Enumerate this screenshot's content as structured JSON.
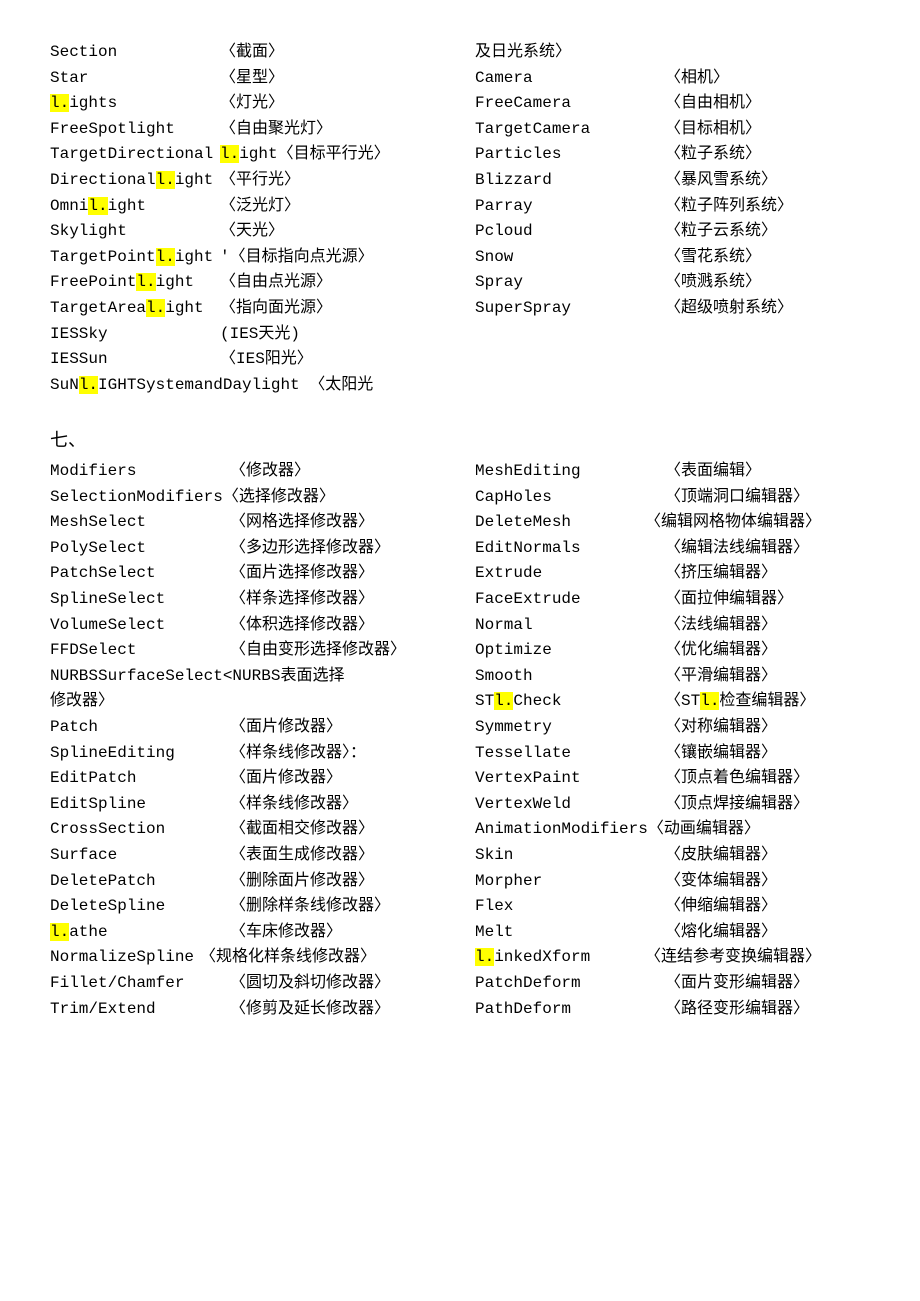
{
  "section1": {
    "left": [
      {
        "term": "Section",
        "def": "〈截面〉"
      },
      {
        "term": "Star",
        "def": "〈星型〉"
      },
      {
        "term_parts": [
          {
            "t": "l.",
            "hl": true
          },
          {
            "t": "ights"
          }
        ],
        "def": "〈灯光〉"
      },
      {
        "term": "FreeSpotlight",
        "def": "〈自由聚光灯〉"
      },
      {
        "term": "TargetDirectional",
        "def_parts": [
          {
            "t": "l.",
            "hl": true
          },
          {
            "t": "ight〈目标平行光〉"
          }
        ]
      },
      {
        "term_parts": [
          {
            "t": "Directional"
          },
          {
            "t": "l.",
            "hl": true
          },
          {
            "t": "ight"
          }
        ],
        "def": "〈平行光〉"
      },
      {
        "term_parts": [
          {
            "t": "Omni"
          },
          {
            "t": "l.",
            "hl": true
          },
          {
            "t": "ight"
          }
        ],
        "def": "〈泛光灯〉"
      },
      {
        "term": "Skylight",
        "def": "〈天光〉"
      },
      {
        "term_parts": [
          {
            "t": "TargetPoint"
          },
          {
            "t": "l.",
            "hl": true
          },
          {
            "t": "ight"
          }
        ],
        "def": "'〈目标指向点光源〉"
      },
      {
        "term_parts": [
          {
            "t": "FreePoint"
          },
          {
            "t": "l.",
            "hl": true
          },
          {
            "t": "ight"
          }
        ],
        "def": "〈自由点光源〉"
      },
      {
        "term_parts": [
          {
            "t": "TargetArea"
          },
          {
            "t": "l.",
            "hl": true
          },
          {
            "t": "ight"
          }
        ],
        "def": "〈指向面光源〉"
      },
      {
        "term": "IESSky",
        "def": "(IES天光)"
      },
      {
        "term": "IESSun",
        "def": "〈IES阳光〉"
      },
      {
        "full_parts": [
          {
            "t": "SuN"
          },
          {
            "t": "l.",
            "hl": true
          },
          {
            "t": "IGHTSystemandDaylight 〈太阳光"
          }
        ]
      }
    ],
    "right": [
      {
        "term": "及日光系统〉",
        "def": ""
      },
      {
        "term": "Camera",
        "def": "〈相机〉"
      },
      {
        "term": "FreeCamera",
        "def": "〈自由相机〉"
      },
      {
        "term": "TargetCamera",
        "def": "〈目标相机〉"
      },
      {
        "term": "Particles",
        "def": "〈粒子系统〉"
      },
      {
        "term": "Blizzard",
        "def": "〈暴风雪系统〉"
      },
      {
        "term": "Parray",
        "def": "〈粒子阵列系统〉"
      },
      {
        "term": "Pcloud",
        "def": "〈粒子云系统〉"
      },
      {
        "term": "Snow",
        "def": "〈雪花系统〉"
      },
      {
        "term": "Spray",
        "def": "〈喷溅系统〉"
      },
      {
        "term": "SuperSpray",
        "def": "〈超级喷射系统〉"
      }
    ]
  },
  "heading7": "七、",
  "section2": {
    "left": [
      {
        "term": "Modifiers",
        "def": "〈修改器〉"
      },
      {
        "term": "SelectionModifiers",
        "def": "〈选择修改器〉",
        "termw": "170"
      },
      {
        "term": "MeshSelect",
        "def": "〈网格选择修改器〉"
      },
      {
        "term": "PolySelect",
        "def": "〈多边形选择修改器〉"
      },
      {
        "term": "PatchSelect",
        "def": "〈面片选择修改器〉",
        "indent": "1"
      },
      {
        "term": "SplineSelect",
        "def": "〈样条选择修改器〉"
      },
      {
        "term": "VolumeSelect",
        "def": "〈体积选择修改器〉"
      },
      {
        "term": "FFDSelect",
        "def": "〈自由变形选择修改器〉"
      },
      {
        "full": "NURBSSurfaceSelect<NURBS表面选择"
      },
      {
        "full": "修改器〉"
      },
      {
        "term": "Patch",
        "def": "〈面片修改器〉"
      },
      {
        "term": "SplineEditing",
        "def": "〈样条线修改器〉："
      },
      {
        "term": "EditPatch",
        "def": "〈面片修改器〉"
      },
      {
        "term": "EditSpline",
        "def": "〈样条线修改器〉"
      },
      {
        "term": "CrossSection",
        "def": "〈截面相交修改器〉"
      },
      {
        "term": "Surface",
        "def": "〈表面生成修改器〉"
      },
      {
        "term": "DeletePatch",
        "def": "〈删除面片修改器〉"
      },
      {
        "term": "DeleteSpline",
        "def": "〈删除样条线修改器〉"
      },
      {
        "term_parts": [
          {
            "t": "l.",
            "hl": true
          },
          {
            "t": "athe"
          }
        ],
        "def": "〈车床修改器〉"
      },
      {
        "term": "NormalizeSpline",
        "def": "〈规格化样条线修改器〉",
        "termw": "150"
      },
      {
        "term": "Fillet/Chamfer",
        "def": "〈圆切及斜切修改器〉"
      },
      {
        "term": "Trim/Extend",
        "def": "〈修剪及延长修改器〉"
      }
    ],
    "right": [
      {
        "term": "MeshEditing",
        "def": "〈表面编辑〉"
      },
      {
        "term": "CapHoles",
        "def": "〈顶端洞口编辑器〉"
      },
      {
        "term": "DeleteMesh",
        "def": "〈编辑网格物体编辑器〉",
        "defshift": "-20"
      },
      {
        "term": "EditNormals",
        "def": "〈编辑法线编辑器〉"
      },
      {
        "term": "Extrude",
        "def": "〈挤压编辑器〉"
      },
      {
        "term": "FaceExtrude",
        "def": "〈面拉伸编辑器〉"
      },
      {
        "term": "Normal",
        "def": "〈法线编辑器〉"
      },
      {
        "term": "Optimize",
        "def": "〈优化编辑器〉"
      },
      {
        "term": "Smooth",
        "def": "〈平滑编辑器〉"
      },
      {
        "term_parts": [
          {
            "t": "ST"
          },
          {
            "t": "l.",
            "hl": true
          },
          {
            "t": "Check"
          }
        ],
        "def_parts": [
          {
            "t": "〈ST"
          },
          {
            "t": "l.",
            "hl": true
          },
          {
            "t": "检查编辑器〉"
          }
        ]
      },
      {
        "term": "Symmetry",
        "def": "〈对称编辑器〉"
      },
      {
        "term": "Tessellate",
        "def": "〈镶嵌编辑器〉"
      },
      {
        "term": "VertexPaint",
        "def": "〈顶点着色编辑器〉"
      },
      {
        "term": "VertexWeld",
        "def": "〈顶点焊接编辑器〉"
      },
      {
        "term": "AnimationModifiers",
        "def": "〈动画编辑器〉",
        "termw": "170"
      },
      {
        "term": "Skin",
        "def": "〈皮肤编辑器〉"
      },
      {
        "term": "Morpher",
        "def": "〈变体编辑器〉"
      },
      {
        "term": "Flex",
        "def": "〈伸缩编辑器〉"
      },
      {
        "term": "Melt",
        "def": "〈熔化编辑器〉"
      },
      {
        "term_parts": [
          {
            "t": "l.",
            "hl": true
          },
          {
            "t": "inkedXform"
          }
        ],
        "def": "〈连结参考变换编辑器〉",
        "defshift": "-20"
      },
      {
        "term": "PatchDeform",
        "def": "〈面片变形编辑器〉"
      },
      {
        "term": "PathDeform",
        "def": "〈路径变形编辑器〉"
      }
    ]
  }
}
